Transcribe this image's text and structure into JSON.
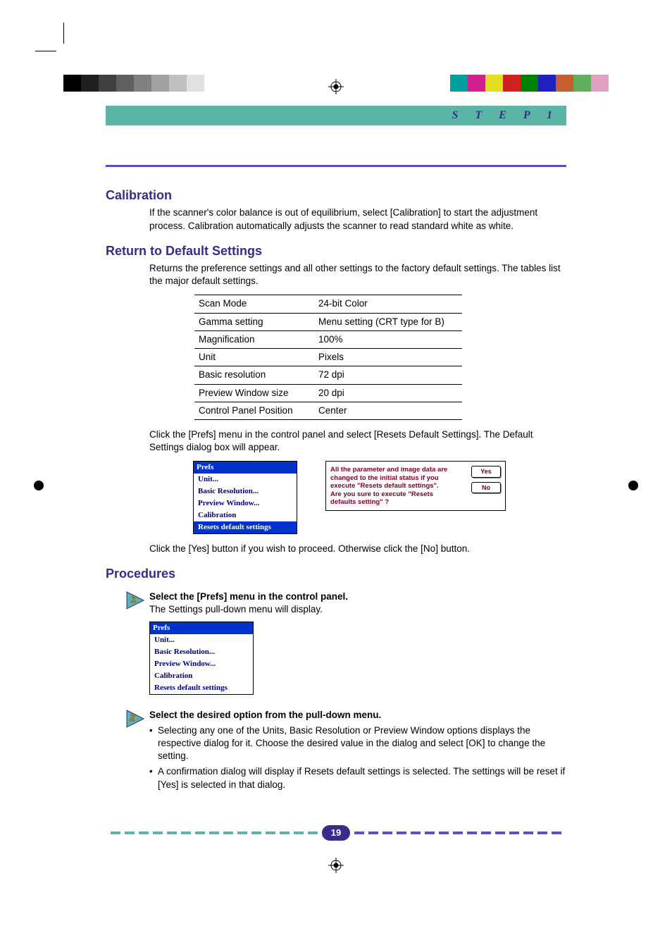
{
  "header": {
    "step_label": "S T E P   1"
  },
  "calibration": {
    "heading": "Calibration",
    "body": "If the scanner's color balance is out of equilibrium, select [Calibration] to start the adjustment process. Calibration automatically adjusts the scanner to read standard white as white."
  },
  "defaults": {
    "heading": "Return to Default Settings",
    "body": "Returns the preference settings and all other settings to the factory default settings. The tables list the major default settings.",
    "table": [
      {
        "label": "Scan Mode",
        "value": "24-bit Color"
      },
      {
        "label": "Gamma setting",
        "value": "Menu setting (CRT type for B)"
      },
      {
        "label": "Magnification",
        "value": "100%"
      },
      {
        "label": "Unit",
        "value": "Pixels"
      },
      {
        "label": "Basic resolution",
        "value": "72 dpi"
      },
      {
        "label": "Preview Window size",
        "value": "20 dpi"
      },
      {
        "label": "Control Panel Position",
        "value": "Center"
      }
    ],
    "after_table": "Click the [Prefs] menu in the control panel and select [Resets Default Settings]. The Default Settings dialog box will appear.",
    "after_dialog": "Click the [Yes] button if you wish to proceed. Otherwise click the [No] button."
  },
  "prefs_menu": {
    "title": "Prefs",
    "items": [
      "Unit...",
      "Basic Resolution...",
      "Preview Window...",
      "Calibration",
      "Resets default settings"
    ],
    "highlighted": 4
  },
  "dialog": {
    "message": "All the parameter and image data are changed to the initial status if you execute \"Resets default settings\". Are you sure to execute \"Resets defaults setting\" ?",
    "yes": "Yes",
    "no": "No"
  },
  "procedures": {
    "heading": "Procedures",
    "step1_title": "Select the [Prefs] menu in the control panel.",
    "step1_body": "The Settings pull-down menu will display.",
    "step2_title": "Select the desired option from the pull-down menu.",
    "step2_bullets": [
      "Selecting any one of the Units, Basic Resolution or Preview Window options displays the respective dialog for it. Choose the desired value in the dialog and select [OK] to change the setting.",
      "A confirmation dialog will display if Resets default settings is selected. The settings will be reset if [Yes] is selected in that dialog."
    ]
  },
  "page_number": "19",
  "gray_shades": [
    "#000000",
    "#202020",
    "#404040",
    "#606060",
    "#808080",
    "#a0a0a0",
    "#c0c0c0",
    "#e0e0e0"
  ],
  "colors": [
    "#00a0a0",
    "#d02090",
    "#e0e020",
    "#d02020",
    "#008000",
    "#2020c0",
    "#c66030",
    "#60b060",
    "#e0a0c0"
  ]
}
